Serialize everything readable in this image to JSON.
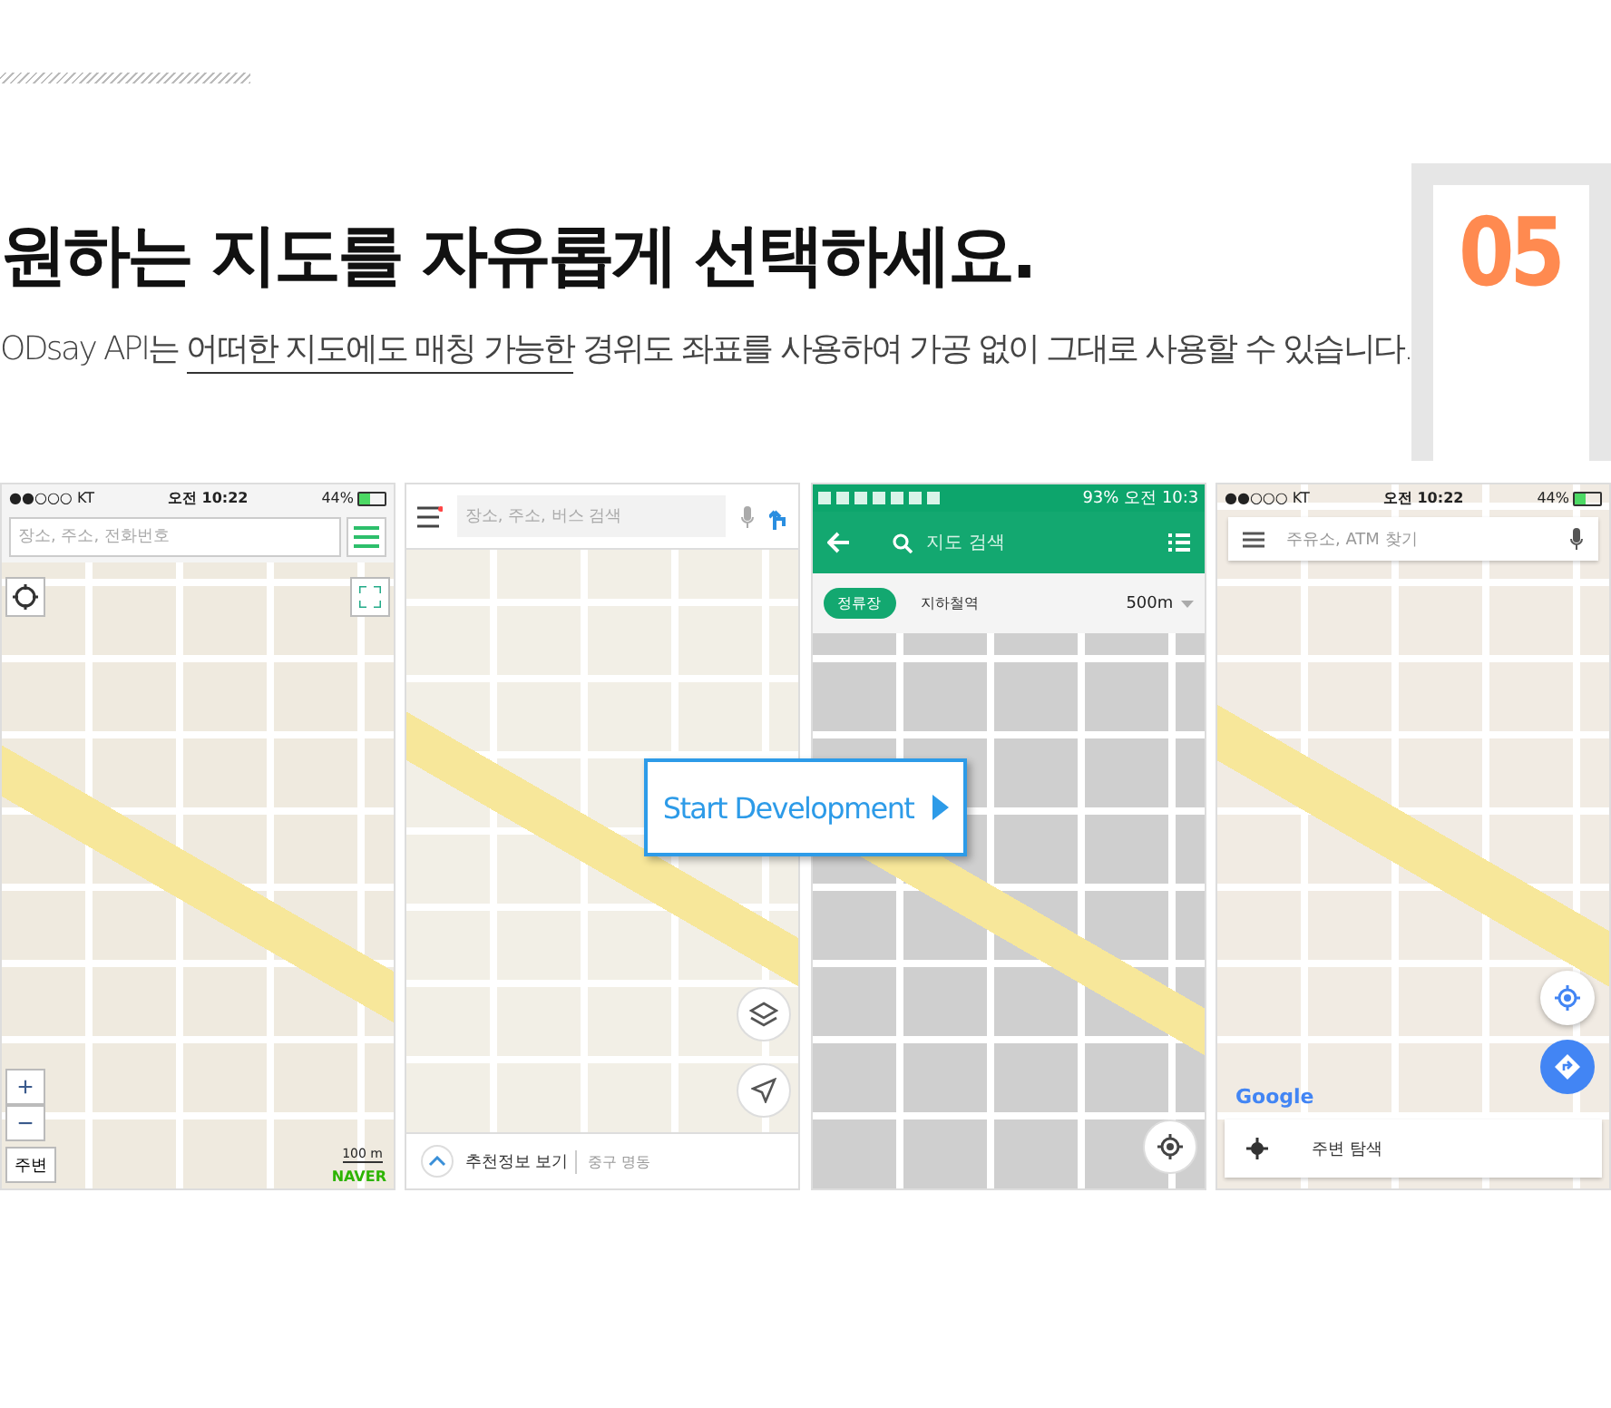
{
  "header": {
    "title": "원하는 지도를 자유롭게 선택하세요.",
    "subtitle_before": "ODsay API는",
    "subtitle_highlight": "어떠한 지도에도 매칭 가능한",
    "subtitle_after": "경위도 좌표를 사용하여 가공 없이 그대로 사용할 수 있습니다.",
    "number": "05"
  },
  "screens": [
    {
      "kind": "ios-search",
      "carrier": "●●○○○ KT",
      "time": "오전 10:22",
      "battery": "44%",
      "placeholder": "장소, 주소, 전화번호",
      "zoom_in": "+",
      "zoom_out": "−",
      "nearby": "주변",
      "scale": "100 m",
      "logo": "NAVER"
    },
    {
      "kind": "bottom-sheet",
      "placeholder": "장소, 주소, 버스 검색",
      "sheet_title": "추천정보 보기",
      "sheet_location": "중구 명동"
    },
    {
      "kind": "android-green",
      "battery": "93%",
      "time": "오전 10:3",
      "placeholder": "지도 검색",
      "chips": [
        {
          "label": "정류장",
          "selected": true
        },
        {
          "label": "지하철역",
          "selected": false
        }
      ],
      "radius": "500m"
    },
    {
      "kind": "ios-card",
      "carrier": "●●○○○ KT",
      "time": "오전 10:22",
      "battery": "44%",
      "placeholder": "주유소, ATM 찾기",
      "logo": "Google",
      "card_label": "주변 탐색"
    }
  ],
  "cta": {
    "label": "Start Development"
  }
}
